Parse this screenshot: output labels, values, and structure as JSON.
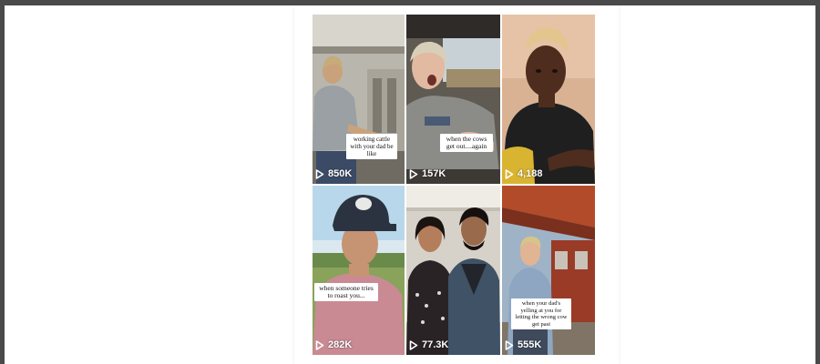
{
  "videos": [
    {
      "caption": "working cattle with your dad be like",
      "views": "850K",
      "play_icon": "play-icon"
    },
    {
      "caption": "when the cows get out....again",
      "views": "157K",
      "play_icon": "play-icon"
    },
    {
      "caption": "",
      "views": "4,188",
      "play_icon": "play-icon"
    },
    {
      "caption": "when someone tries to roast you...",
      "views": "282K",
      "play_icon": "play-icon"
    },
    {
      "caption": "",
      "views": "77.3K",
      "play_icon": "play-icon"
    },
    {
      "caption": "when your dad's yelling at you for letting the wrong cow get past",
      "views": "555K",
      "play_icon": "play-icon"
    }
  ]
}
